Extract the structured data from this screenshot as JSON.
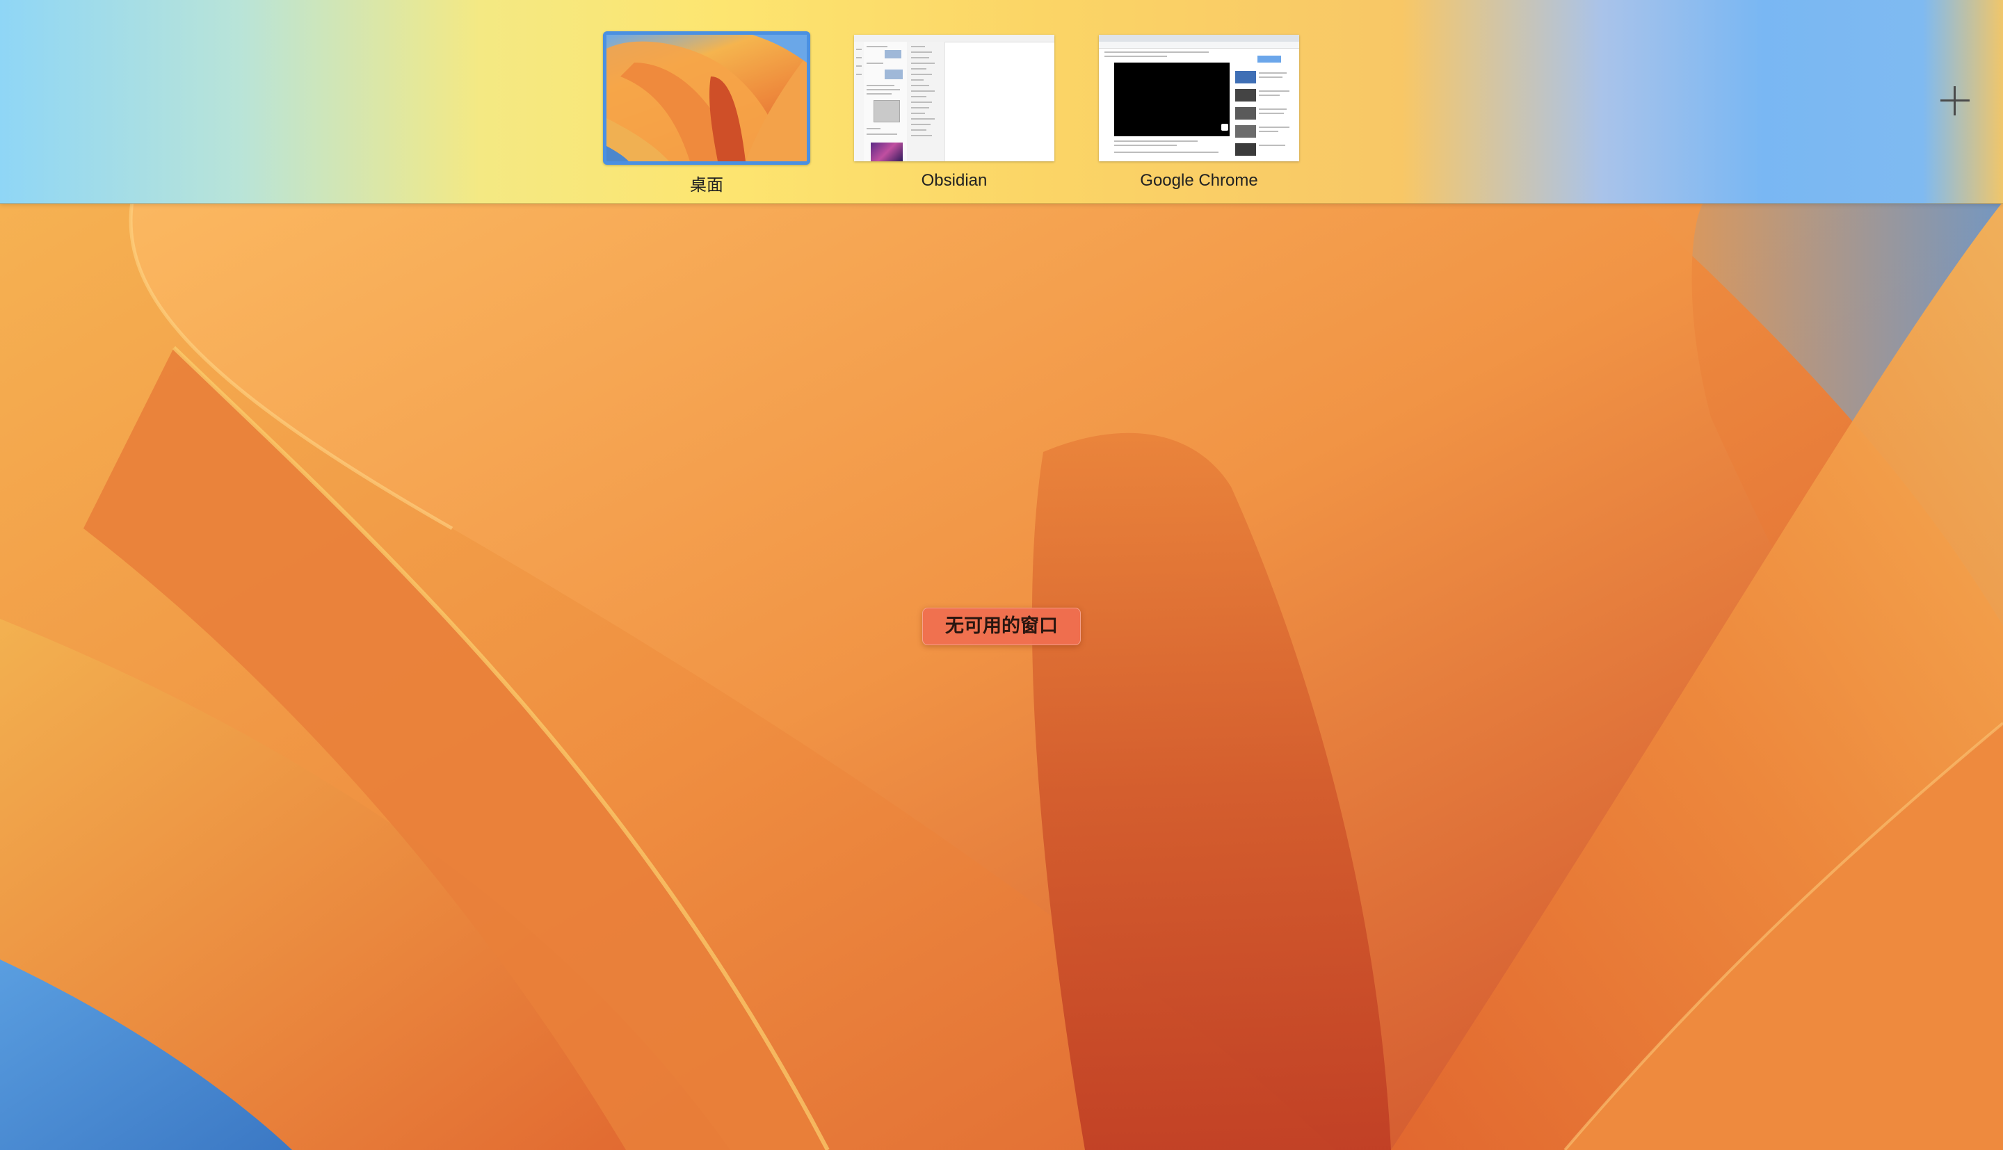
{
  "spaces_bar": {
    "spaces": [
      {
        "label": "桌面",
        "selected": true,
        "kind": "desktop"
      },
      {
        "label": "Obsidian",
        "selected": false,
        "kind": "app-window"
      },
      {
        "label": "Google Chrome",
        "selected": false,
        "kind": "app-window"
      }
    ],
    "add_space_icon": "plus-icon"
  },
  "desktop": {
    "empty_message": "无可用的窗口"
  },
  "colors": {
    "selection_border": "#4a90e2",
    "badge_background": "#f06e50"
  }
}
